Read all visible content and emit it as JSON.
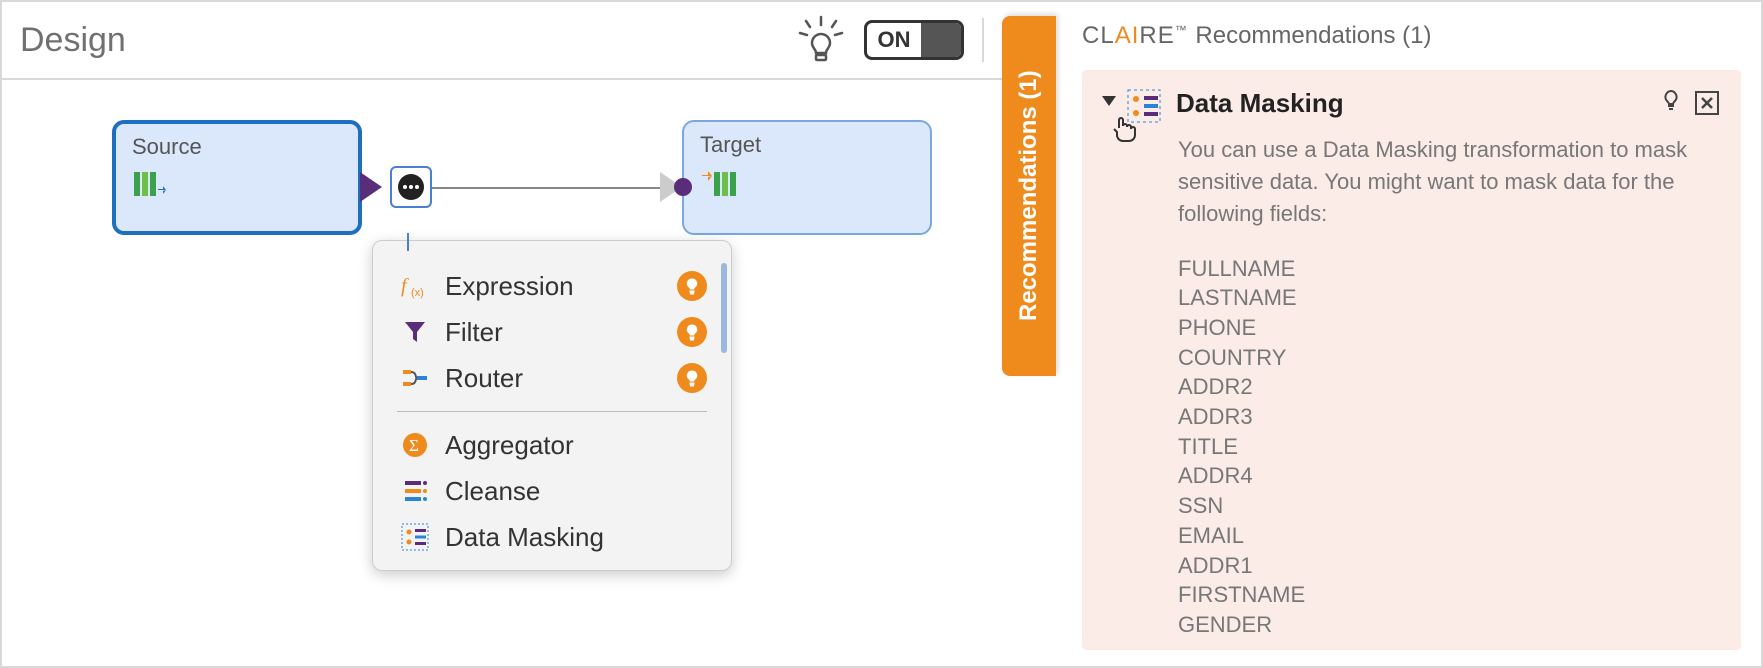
{
  "header": {
    "title": "Design",
    "toggle_label": "ON"
  },
  "canvas": {
    "source_label": "Source",
    "target_label": "Target"
  },
  "tx_menu": {
    "items": [
      {
        "label": "Expression",
        "icon": "fx",
        "rec": true
      },
      {
        "label": "Filter",
        "icon": "funnel",
        "rec": true
      },
      {
        "label": "Router",
        "icon": "router",
        "rec": true
      }
    ],
    "more": [
      {
        "label": "Aggregator",
        "icon": "sigma"
      },
      {
        "label": "Cleanse",
        "icon": "cleanse"
      },
      {
        "label": "Data Masking",
        "icon": "mask"
      }
    ]
  },
  "rec_tab": {
    "label": "Recommendations (1)"
  },
  "rec_panel": {
    "brand_prefix": "CL",
    "brand_accent": "AI",
    "brand_suffix": "RE",
    "brand_tm": "™",
    "title_rest": " Recommendations (1)",
    "card": {
      "title": "Data Masking",
      "desc": "You can use a Data Masking transformation to mask sensitive data. You might want to mask data for the following fields:",
      "fields": [
        "FULLNAME",
        "LASTNAME",
        "PHONE",
        "COUNTRY",
        "ADDR2",
        "ADDR3",
        "TITLE",
        "ADDR4",
        "SSN",
        "EMAIL",
        "ADDR1",
        "FIRSTNAME",
        "GENDER"
      ]
    }
  }
}
